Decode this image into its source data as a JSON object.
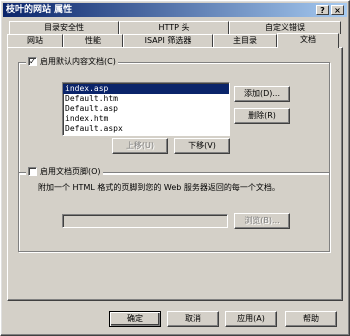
{
  "window": {
    "title": "枝叶的网站 属性"
  },
  "titlebar_buttons": {
    "help": "?",
    "close": "×"
  },
  "tabs_back": [
    {
      "label": "目录安全性"
    },
    {
      "label": "HTTP 头"
    },
    {
      "label": "自定义错误"
    }
  ],
  "tabs_front": [
    {
      "label": "网站"
    },
    {
      "label": "性能"
    },
    {
      "label": "ISAPI 筛选器"
    },
    {
      "label": "主目录"
    },
    {
      "label": "文档"
    }
  ],
  "default_doc": {
    "checkbox_label": "启用默认内容文档(C)",
    "checked": true,
    "items": [
      "index.asp",
      "Default.htm",
      "Default.asp",
      "index.htm",
      "Default.aspx"
    ],
    "selected_index": 0,
    "add_label": "添加(D)...",
    "remove_label": "删除(R)",
    "move_up_label": "上移(U)",
    "move_down_label": "下移(V)"
  },
  "footer": {
    "checkbox_label": "启用文档页脚(O)",
    "checked": false,
    "description": "附加一个 HTML 格式的页脚到您的 Web 服务器返回的每一个文档。",
    "path_value": "",
    "browse_label": "浏览(B)..."
  },
  "dialog_buttons": {
    "ok": "确定",
    "cancel": "取消",
    "apply": "应用(A)",
    "help": "帮助"
  }
}
